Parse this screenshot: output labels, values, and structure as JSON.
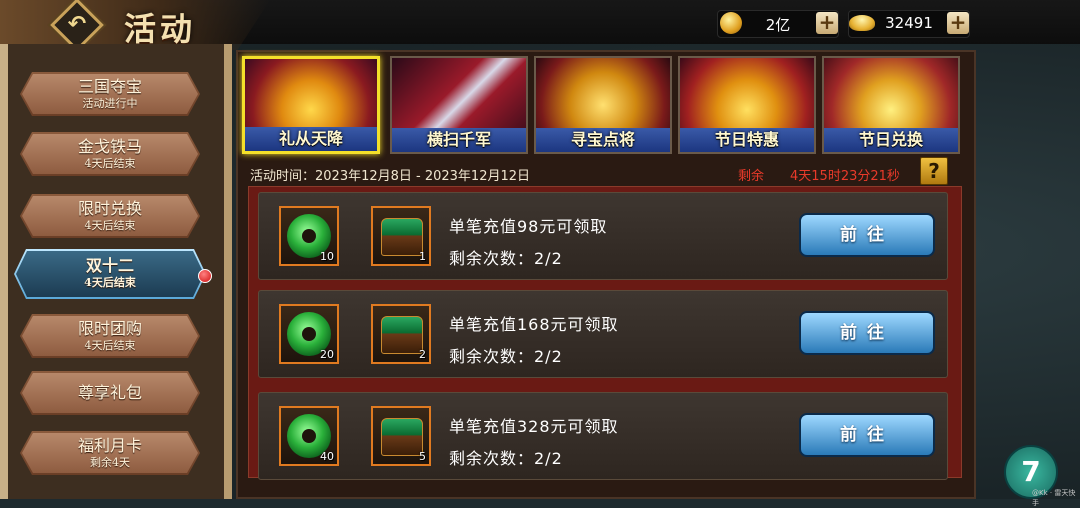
{
  "header": {
    "title": "活动",
    "back_icon": "↶",
    "gold": "2亿",
    "ingot": "32491",
    "plus": "+"
  },
  "sidebar": {
    "items": [
      {
        "label": "三国夺宝",
        "status": "活动进行中"
      },
      {
        "label": "金戈铁马",
        "status": "4天后结束"
      },
      {
        "label": "限时兑换",
        "status": "4天后结束"
      },
      {
        "label": "双十二",
        "status": "4天后结束",
        "active": true
      },
      {
        "label": "限时团购",
        "status": "4天后结束",
        "badge": true
      },
      {
        "label": "尊享礼包",
        "status": ""
      },
      {
        "label": "福利月卡",
        "status": "剩余4天"
      }
    ]
  },
  "banners": [
    {
      "label": "礼从天降",
      "selected": true
    },
    {
      "label": "横扫千军"
    },
    {
      "label": "寻宝点将"
    },
    {
      "label": "节日特惠"
    },
    {
      "label": "节日兑换"
    }
  ],
  "activity": {
    "time": "活动时间：2023年12月8日 - 2023年12月12日",
    "remain_label": "剩余",
    "remain_value": "4天15时23分21秒",
    "help": "?"
  },
  "rewards": [
    {
      "title": "单笔充值98元可领取",
      "count": "剩余次数：2/2",
      "item1_qty": "10",
      "item2_qty": "1",
      "button": "前往"
    },
    {
      "title": "单笔充值168元可领取",
      "count": "剩余次数：2/2",
      "item1_qty": "20",
      "item2_qty": "2",
      "button": "前往"
    },
    {
      "title": "单笔充值328元可领取",
      "count": "剩余次数：2/2",
      "item1_qty": "40",
      "item2_qty": "5",
      "button": "前往"
    }
  ],
  "corner": {
    "badge": "7",
    "watermark": "@Kk · 雷天快手"
  },
  "colors": {
    "accent_gold": "#f4e02a",
    "remain_red": "#e83a2a",
    "button_blue": "#2a7ab8"
  }
}
